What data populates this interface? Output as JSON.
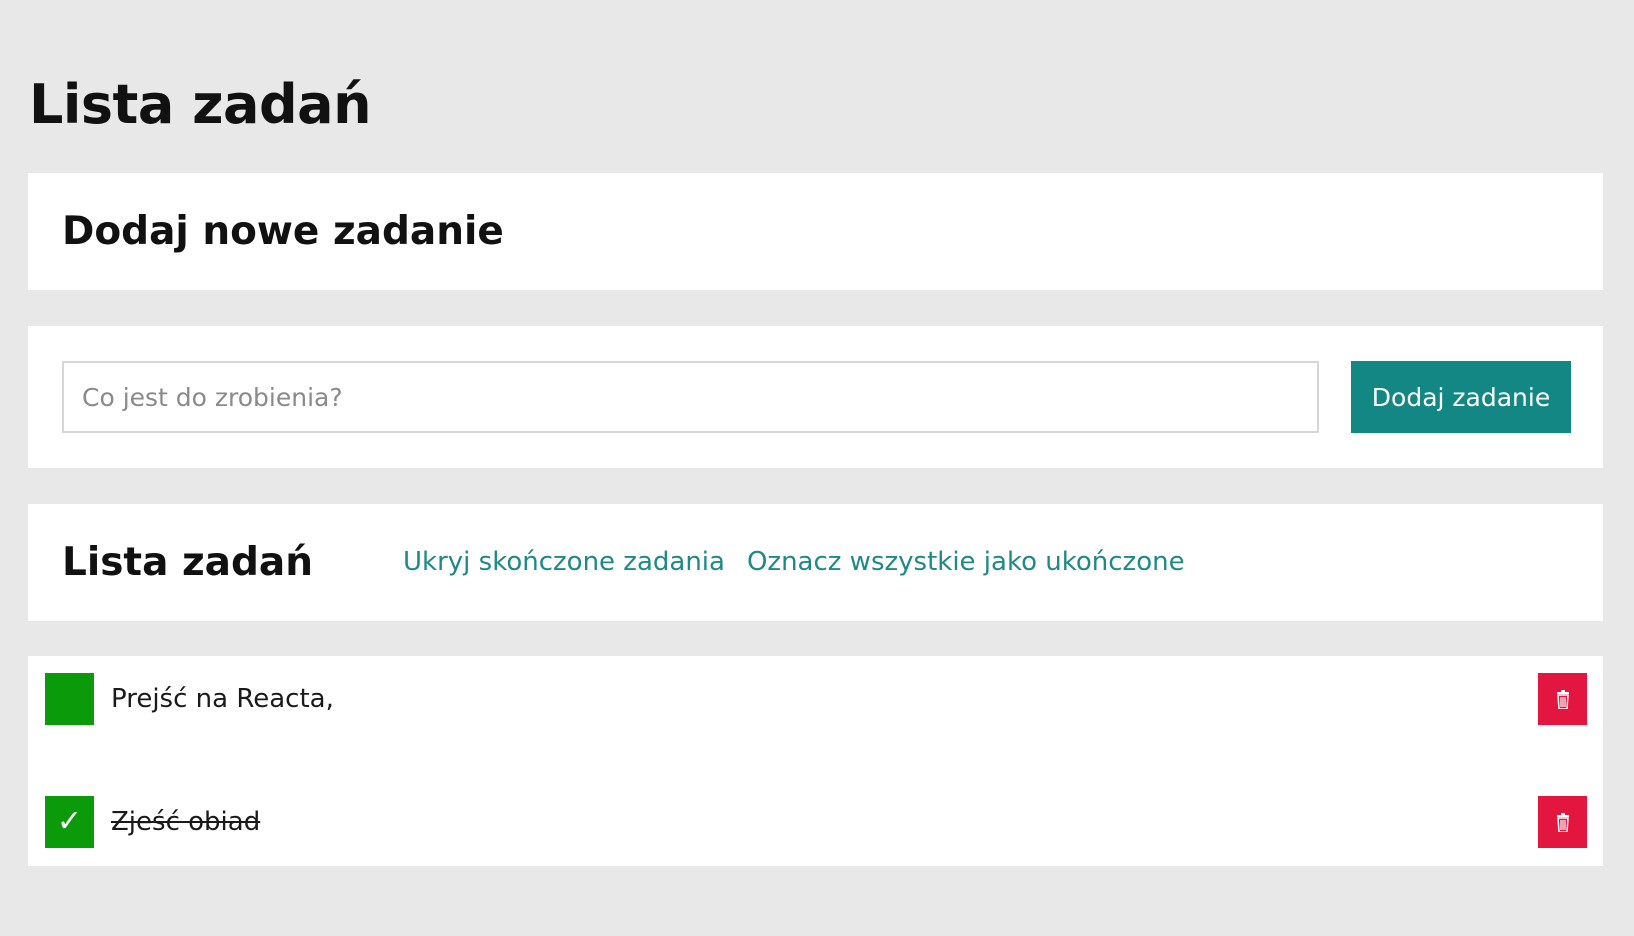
{
  "header": {
    "title": "Lista zadań"
  },
  "add_section": {
    "title": "Dodaj nowe zadanie",
    "input_placeholder": "Co jest do zrobienia?",
    "input_value": "",
    "button_label": "Dodaj zadanie"
  },
  "list_section": {
    "title": "Lista zadań",
    "hide_completed_label": "Ukryj skończone zadania",
    "mark_all_label": "Oznacz wszystkie jako ukończone"
  },
  "tasks": [
    {
      "text": "Prejść na Reacta,",
      "done": false
    },
    {
      "text": "Zjeść obiad",
      "done": true
    }
  ],
  "icons": {
    "checkmark": "✓",
    "delete": "trash-icon"
  },
  "colors": {
    "accent": "#128783",
    "link": "#1f8a85",
    "checkbox": "#0a9a0a",
    "delete": "#e2163f",
    "background": "#e8e8e8"
  }
}
